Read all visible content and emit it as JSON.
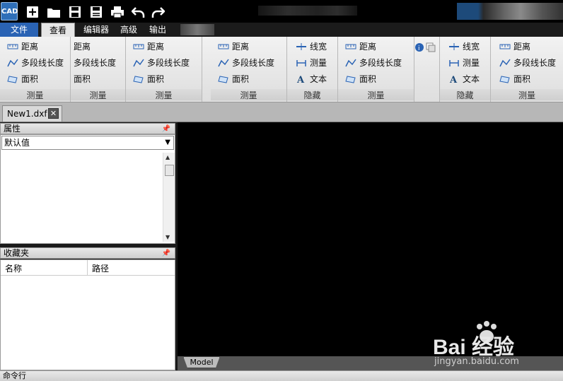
{
  "app": {
    "logo_text": "CAD"
  },
  "ribbon_tabs": [
    {
      "label": "文件"
    },
    {
      "label": "查看器"
    },
    {
      "label": "编辑器"
    },
    {
      "label": "高级"
    },
    {
      "label": "输出"
    }
  ],
  "ribbon": {
    "distance": "距离",
    "polyline_length": "多段线长度",
    "area": "面积",
    "measure_group": "测量",
    "line_width": "线宽",
    "measure": "测量",
    "text": "文本",
    "hide_group": "隐藏"
  },
  "document": {
    "tab_label": "New1.dxf"
  },
  "properties_panel": {
    "title": "属性",
    "selected": "默认值"
  },
  "favorites_panel": {
    "title": "收藏夹",
    "columns": [
      "名称",
      "路径"
    ]
  },
  "canvas": {
    "layout_tab": "Model"
  },
  "command_line": {
    "label": "命令行"
  },
  "watermark": {
    "main": "Bai  经验",
    "sub": "jingyan.baidu.com"
  },
  "colors": {
    "file_tab": "#2a63b4",
    "canvas": "#000000",
    "ribbon": "#e6e6e6"
  }
}
